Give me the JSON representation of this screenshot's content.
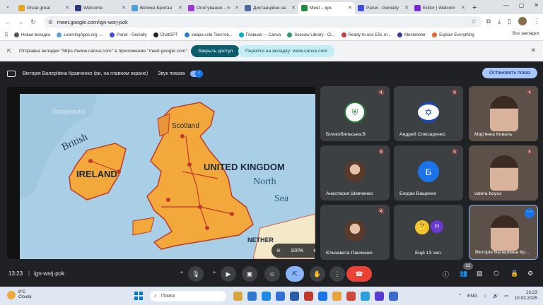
{
  "browser": {
    "tabs": [
      {
        "label": "Great great",
        "color": "#e5a722"
      },
      {
        "label": "Welcome",
        "color": "#2f3b7a"
      },
      {
        "label": "Велика Британ",
        "color": "#4aa0d8"
      },
      {
        "label": "Опитування – h",
        "color": "#9a3ad0"
      },
      {
        "label": "Дистанційне на",
        "color": "#4a6aa0"
      },
      {
        "label": "Meet – ign-",
        "color": "#1e8e3e",
        "active": true
      },
      {
        "label": "Panel - Genially",
        "color": "#3d4ee0"
      },
      {
        "label": "Editor | Welcom",
        "color": "#7a2ad0"
      }
    ],
    "url": "meet.google.com/ign-wsrj-pok",
    "bookmarks": [
      {
        "label": "Новая вкладка",
        "color": "#555555"
      },
      {
        "label": "LearningApps.org -...",
        "color": "#5aa0d8"
      },
      {
        "label": "Panel - Genially",
        "color": "#3d4ee0"
      },
      {
        "label": "ChatGPT",
        "color": "#222222"
      },
      {
        "label": "хмара слів Текстов...",
        "color": "#2a7ad0"
      },
      {
        "label": "Главная — Canva",
        "color": "#00b3c4"
      },
      {
        "label": "Seesaw Library - Cl...",
        "color": "#2b9a6a"
      },
      {
        "label": "Ready-to-use ESL m...",
        "color": "#c43a3a"
      },
      {
        "label": "Mentimeter",
        "color": "#3a3a9a"
      },
      {
        "label": "Explain Everything",
        "color": "#e06a2a"
      }
    ],
    "all_bookmarks": "Все закладки"
  },
  "share_banner": {
    "text": "Отправка вкладки \"https://www.canva.com\" в приложение \"meet.google.com\".",
    "access_button": "Закрыть доступ",
    "switch_button": "Перейти на вкладку: www.canva.com"
  },
  "meet": {
    "presenter_text": "Вікторія Валеріївна Кравченко (ви, на главном экране)",
    "audio_label": "Звук показа",
    "stop_button": "Остановить показ",
    "zoom_level": "100%",
    "map_labels": {
      "ireland": "IRELAND",
      "uk": "UNITED KINGDOM",
      "scotland": "Scotland",
      "north": "North",
      "sea": "Sea",
      "british": "British",
      "netherlands": "NETHER",
      "watermark": "Storyblocks"
    },
    "participants": [
      {
        "name": "Білокобильська.В",
        "type": "crest"
      },
      {
        "name": "Андрей Слюсаренко",
        "type": "flag"
      },
      {
        "name": "Мар'янка Коваль",
        "type": "video"
      },
      {
        "name": "Анастасия Шевченко",
        "type": "photo"
      },
      {
        "name": "Богдан Ващенко",
        "type": "letter",
        "letter": "Б"
      },
      {
        "name": "valera boyus",
        "type": "video"
      },
      {
        "name": "Єлизавета Панченко",
        "type": "photo"
      },
      {
        "name": "Ещё 13 чел.",
        "type": "more",
        "letter": "Н"
      },
      {
        "name": "Вікторія Валеріївна Кр...",
        "type": "video"
      }
    ],
    "time": "13:23",
    "separator": "|",
    "meeting_code": "ign-wsrj-pok",
    "people_count": "22"
  },
  "taskbar": {
    "temperature": "8°C",
    "weather": "Cloudy",
    "search_placeholder": "Поиск",
    "language": "ENG",
    "clock_time": "13:23",
    "clock_date": "10.03.2025"
  }
}
